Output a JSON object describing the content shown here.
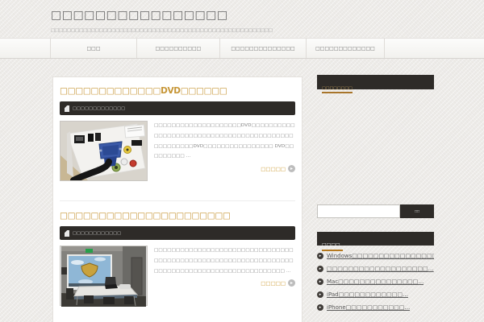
{
  "colors": {
    "accent_orange": "#c69535",
    "underline_orange": "#b5791e",
    "dark_bar": "#2e2b28",
    "page_background": "#edebe8"
  },
  "header": {
    "site_title": "□□□□□□□□□□□□□□□□",
    "tagline": "□□□□□□□□□□□□□□□□□□□□□□□□□□□□□□□□□□□□□□□□□□□□□□□□□□□□□□□"
  },
  "nav": {
    "items": [
      {
        "label": "□□□"
      },
      {
        "label": "□□□□□□□□□□"
      },
      {
        "label": "□□□□□□□□□□□□□□"
      },
      {
        "label": "□□□□□□□□□□□□□"
      }
    ]
  },
  "main": {
    "articles": [
      {
        "title": "□□□□□□□□□□□□□DVD□□□□□□",
        "category": "□□□□□□□□□□□□□",
        "excerpt": "□□□□□□□□□□□□□□□□□□□□DVD□□□□□□□□□□□□□□□□□□□□□□□□□□□□□□□□□□□□□□□□□□□□□□□□□□□DVD□□□□□□□□□□□□□□□□ DVD□□□□□□□□□ …",
        "read_more": "□□□□□"
      },
      {
        "title": "□□□□□□□□□□□□□□□□□□□□□□",
        "category": "□□□□□□□□□□□□",
        "excerpt": "□□□□□□□□□□□□□□□□□□□□□□□□□□□□□□□□□□□□□□□□□□□□□□□□□□□□□□□□□□□□□□□□□□□□□□□□□□□□□□□□□□□□□□□□□□□□□□ …",
        "read_more": "□□□□□"
      }
    ]
  },
  "sidebar": {
    "promo_link": "□□□□□□□□",
    "search": {
      "value": "",
      "button_label": "□□"
    },
    "recent": {
      "title": "□□□□",
      "items": [
        "Windows□□□□□□□□□□□□□□□□□…",
        "□□□□□□□□□□□□□□□□□□□…",
        "Mac□□□□□□□□□□□□□□□…",
        "iPad□□□□□□□□□□□□…",
        "iPhone□□□□□□□□□□□…"
      ]
    }
  },
  "icons": {
    "bullet_arrow": "▸",
    "read_more_arrow": "▸"
  }
}
